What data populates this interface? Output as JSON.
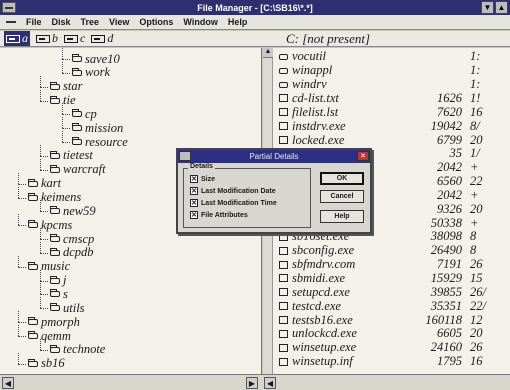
{
  "window": {
    "title": "File Manager - [C:\\SB16\\*.*]",
    "min_label": "▼",
    "max_label": "▲"
  },
  "menu": {
    "items": [
      "File",
      "Disk",
      "Tree",
      "View",
      "Options",
      "Window",
      "Help"
    ]
  },
  "drives": [
    {
      "letter": "a",
      "selected": true
    },
    {
      "letter": "b",
      "selected": false
    },
    {
      "letter": "c",
      "selected": false
    },
    {
      "letter": "d",
      "selected": false
    }
  ],
  "path_label": "C: [not present]",
  "tree": {
    "items": [
      {
        "label": "save10",
        "depth": 3
      },
      {
        "label": "work",
        "depth": 3
      },
      {
        "label": "star",
        "depth": 2
      },
      {
        "label": "tie",
        "depth": 2
      },
      {
        "label": "cp",
        "depth": 3
      },
      {
        "label": "mission",
        "depth": 3
      },
      {
        "label": "resource",
        "depth": 3
      },
      {
        "label": "tietest",
        "depth": 2
      },
      {
        "label": "warcraft",
        "depth": 2
      },
      {
        "label": "kart",
        "depth": 1
      },
      {
        "label": "keimens",
        "depth": 1
      },
      {
        "label": "new59",
        "depth": 2
      },
      {
        "label": "kpcms",
        "depth": 1
      },
      {
        "label": "cmscp",
        "depth": 2
      },
      {
        "label": "dcpdb",
        "depth": 2
      },
      {
        "label": "music",
        "depth": 1
      },
      {
        "label": "j",
        "depth": 2
      },
      {
        "label": "s",
        "depth": 2
      },
      {
        "label": "utils",
        "depth": 2
      },
      {
        "label": "pmorph",
        "depth": 1
      },
      {
        "label": "qemm",
        "depth": 1
      },
      {
        "label": "technote",
        "depth": 2
      },
      {
        "label": "sb16",
        "depth": 1
      }
    ]
  },
  "files": {
    "rows": [
      {
        "name": "vocutil",
        "size": "",
        "date": "1:",
        "dir": true
      },
      {
        "name": "winappl",
        "size": "",
        "date": "1:",
        "dir": true
      },
      {
        "name": "windrv",
        "size": "",
        "date": "1:",
        "dir": true
      },
      {
        "name": "cd-list.txt",
        "size": "1626",
        "date": "1!",
        "dir": false
      },
      {
        "name": "filelist.lst",
        "size": "7620",
        "date": "16",
        "dir": false
      },
      {
        "name": "instdrv.exe",
        "size": "19042",
        "date": "8/",
        "dir": false
      },
      {
        "name": "locked.exe",
        "size": "6799",
        "date": "20",
        "dir": false
      },
      {
        "name": "",
        "size": "35",
        "date": "1/",
        "dir": false
      },
      {
        "name": "",
        "size": "2042",
        "date": "+",
        "dir": false
      },
      {
        "name": "",
        "size": "6560",
        "date": "22",
        "dir": false
      },
      {
        "name": "",
        "size": "2042",
        "date": "+",
        "dir": false
      },
      {
        "name": "",
        "size": "9326",
        "date": "20",
        "dir": false
      },
      {
        "name": "",
        "size": "50338",
        "date": "+",
        "dir": false
      },
      {
        "name": "sb16set.exe",
        "size": "38098",
        "date": "8",
        "dir": false
      },
      {
        "name": "sbconfig.exe",
        "size": "26490",
        "date": "8",
        "dir": false
      },
      {
        "name": "sbfmdrv.com",
        "size": "7191",
        "date": "26",
        "dir": false
      },
      {
        "name": "sbmidi.exe",
        "size": "15929",
        "date": "15",
        "dir": false
      },
      {
        "name": "setupcd.exe",
        "size": "39855",
        "date": "26/",
        "dir": false
      },
      {
        "name": "testcd.exe",
        "size": "35351",
        "date": "22/",
        "dir": false
      },
      {
        "name": "testsb16.exe",
        "size": "160118",
        "date": "12",
        "dir": false
      },
      {
        "name": "unlockcd.exe",
        "size": "6605",
        "date": "20",
        "dir": false
      },
      {
        "name": "winsetup.exe",
        "size": "24160",
        "date": "26",
        "dir": false
      },
      {
        "name": "winsetup.inf",
        "size": "1795",
        "date": "16",
        "dir": false
      }
    ]
  },
  "dialog": {
    "title": "Partial Details",
    "group_label": "Details",
    "options": [
      {
        "label": "Size",
        "checked": true
      },
      {
        "label": "Last Modification Date",
        "checked": true
      },
      {
        "label": "Last Modification Time",
        "checked": true
      },
      {
        "label": "File Attributes",
        "checked": true
      }
    ],
    "ok_label": "OK",
    "cancel_label": "Cancel",
    "help_label": "Help"
  },
  "colors": {
    "titlebar": "#2e2e70",
    "dialog_title": "#2d2f82",
    "pane_bg": "#f3f1ea"
  }
}
